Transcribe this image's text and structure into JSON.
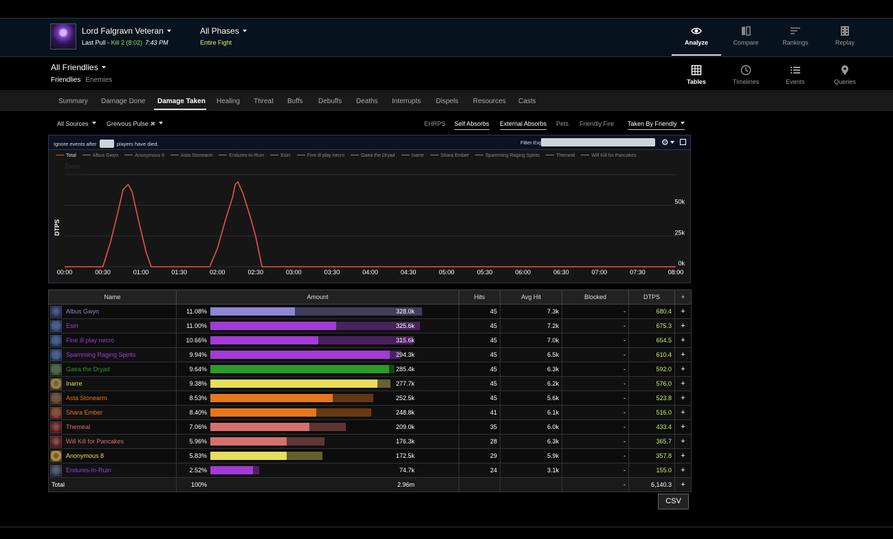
{
  "header": {
    "boss_name": "Lord Falgravn Veteran",
    "pull_prefix": "Last Pull - ",
    "pull_kill": "Kill 2 (8:02)",
    "pull_time": "7:43 PM",
    "phase_name": "All Phases",
    "phase_sub": "Entire Fight",
    "nav": [
      {
        "label": "Analyze",
        "icon": "eye-icon"
      },
      {
        "label": "Compare",
        "icon": "compare-icon"
      },
      {
        "label": "Rankings",
        "icon": "rankings-icon"
      },
      {
        "label": "Replay",
        "icon": "film-icon"
      }
    ]
  },
  "subheader": {
    "title": "All Friendlies",
    "tab_friendlies": "Friendlies",
    "tab_enemies": "Enemies",
    "nav": [
      {
        "label": "Tables",
        "icon": "grid-icon"
      },
      {
        "label": "Timelines",
        "icon": "clock-icon"
      },
      {
        "label": "Events",
        "icon": "list-icon"
      },
      {
        "label": "Queries",
        "icon": "map-pin-icon"
      }
    ]
  },
  "tabs": [
    "Summary",
    "Damage Done",
    "Damage Taken",
    "Healing",
    "Threat",
    "Buffs",
    "Debuffs",
    "Deaths",
    "Interrupts",
    "Dispels",
    "Resources",
    "Casts"
  ],
  "active_tab": "Damage Taken",
  "filters": {
    "sources": "All Sources",
    "ability": "Greivous Pulse",
    "ehrps": "EHRPS",
    "self_absorbs": "Self Absorbs",
    "external_absorbs": "External Absorbs",
    "pets": "Pets",
    "friendly_fire": "Friendly Fire",
    "taken_by": "Taken By Friendly"
  },
  "ignore": {
    "before": "Ignore events after",
    "after": "players have died.",
    "filter_label": "Filter Expression:",
    "filter_value": ""
  },
  "legend": [
    "Total",
    "Albus Gwyn",
    "Anonymous 8",
    "Asta Stonearm",
    "Endures-In-Ruin",
    "Esirr",
    "Fine ill play necro",
    "Gaea the Dryad",
    "Inarre",
    "Shara Ember",
    "Spamming Raging Spirits",
    "Themeal",
    "Will Kill for Pancakes"
  ],
  "chart_data": {
    "type": "line",
    "ylabel": "DTPS",
    "zoom_label": "Zoom",
    "x_ticks": [
      "00:00",
      "00:30",
      "01:00",
      "01:30",
      "02:00",
      "02:30",
      "03:00",
      "03:30",
      "04:00",
      "04:30",
      "05:00",
      "05:30",
      "06:00",
      "06:30",
      "07:00",
      "07:30",
      "08:00"
    ],
    "y_ticks": [
      "0k",
      "25k",
      "50k"
    ],
    "ylim": [
      0,
      75000
    ],
    "xlim_seconds": [
      0,
      480
    ],
    "series": [
      {
        "name": "Total",
        "color": "#e8524a",
        "points": [
          [
            0,
            0
          ],
          [
            30,
            0
          ],
          [
            36,
            20000
          ],
          [
            42,
            45000
          ],
          [
            46,
            63000
          ],
          [
            50,
            67000
          ],
          [
            53,
            61000
          ],
          [
            58,
            38000
          ],
          [
            64,
            12000
          ],
          [
            68,
            0
          ],
          [
            114,
            0
          ],
          [
            120,
            15000
          ],
          [
            126,
            37000
          ],
          [
            132,
            57000
          ],
          [
            134,
            67000
          ],
          [
            136,
            69000
          ],
          [
            140,
            60000
          ],
          [
            146,
            40000
          ],
          [
            150,
            25000
          ],
          [
            153,
            10000
          ],
          [
            155,
            0
          ],
          [
            480,
            0
          ]
        ]
      }
    ]
  },
  "table": {
    "headers": [
      "Name",
      "Amount",
      "Hits",
      "Avg Hit",
      "Blocked",
      "DTPS",
      "+"
    ],
    "rows": [
      {
        "name": "Albus Gwyn",
        "color": "#8f86d8",
        "pct": "11.08%",
        "frac": 0.4,
        "amount": "328.0k",
        "hits": "45",
        "avg": "7.3k",
        "blocked": "-",
        "dtps": "680.4",
        "bar_full": 1.0,
        "icon_bg": "#2d3f8a"
      },
      {
        "name": "Esirr",
        "color": "#a23bd6",
        "pct": "11.00%",
        "frac": 0.6,
        "amount": "325.6k",
        "hits": "45",
        "avg": "7.2k",
        "blocked": "-",
        "dtps": "675.3",
        "bar_full": 0.99,
        "icon_bg": "#2d57a8"
      },
      {
        "name": "Fine ill play necro",
        "color": "#a23bd6",
        "pct": "10.66%",
        "frac": 0.53,
        "amount": "315.6k",
        "hits": "45",
        "avg": "7.0k",
        "blocked": "-",
        "dtps": "654.5",
        "bar_full": 0.96,
        "icon_bg": "#2d57a8"
      },
      {
        "name": "Spamming Raging Spirits",
        "color": "#a23bd6",
        "pct": "9.94%",
        "frac": 0.94,
        "amount": "294.3k",
        "hits": "45",
        "avg": "6.5k",
        "blocked": "-",
        "dtps": "610.4",
        "bar_full": 0.9,
        "icon_bg": "#2d57a8"
      },
      {
        "name": "Gaea the Dryad",
        "color": "#2a9a2a",
        "pct": "9.64%",
        "frac": 0.97,
        "amount": "285.4k",
        "hits": "45",
        "avg": "6.3k",
        "blocked": "-",
        "dtps": "592.0",
        "bar_full": 0.87,
        "icon_bg": "#3f6e3a"
      },
      {
        "name": "Inarre",
        "color": "#e8de58",
        "pct": "9.38%",
        "frac": 0.93,
        "amount": "277.7k",
        "hits": "45",
        "avg": "6.2k",
        "blocked": "-",
        "dtps": "576.0",
        "bar_full": 0.85,
        "icon_bg": "#b08a30"
      },
      {
        "name": "Asta Stonearm",
        "color": "#e8771c",
        "pct": "8.53%",
        "frac": 0.75,
        "amount": "252.5k",
        "hits": "45",
        "avg": "5.6k",
        "blocked": "-",
        "dtps": "523.8",
        "bar_full": 0.77,
        "icon_bg": "#7a4a2a"
      },
      {
        "name": "Shara Ember",
        "color": "#e8771c",
        "pct": "8.40%",
        "frac": 0.66,
        "amount": "248.8k",
        "hits": "41",
        "avg": "6.1k",
        "blocked": "-",
        "dtps": "516.0",
        "bar_full": 0.76,
        "icon_bg": "#a83a1a"
      },
      {
        "name": "Themeal",
        "color": "#d6706e",
        "pct": "7.06%",
        "frac": 0.73,
        "amount": "209.0k",
        "hits": "35",
        "avg": "6.0k",
        "blocked": "-",
        "dtps": "433.4",
        "bar_full": 0.64,
        "icon_bg": "#8a1a1a"
      },
      {
        "name": "Will Kill for Pancakes",
        "color": "#d6706e",
        "pct": "5.96%",
        "frac": 0.67,
        "amount": "176.3k",
        "hits": "28",
        "avg": "6.3k",
        "blocked": "-",
        "dtps": "365.7",
        "bar_full": 0.54,
        "icon_bg": "#8a1a1a"
      },
      {
        "name": "Anonymous 8",
        "color": "#e8de58",
        "pct": "5.83%",
        "frac": 0.68,
        "amount": "172.5k",
        "hits": "29",
        "avg": "5.9k",
        "blocked": "-",
        "dtps": "357.8",
        "bar_full": 0.53,
        "icon_bg": "#c89a20"
      },
      {
        "name": "Endures-In-Ruin",
        "color": "#a23bd6",
        "pct": "2.52%",
        "frac": 0.87,
        "amount": "74.7k",
        "hits": "24",
        "avg": "3.1k",
        "blocked": "-",
        "dtps": "155.0",
        "bar_full": 0.23,
        "icon_bg": "#3a4a6a"
      }
    ],
    "total": {
      "name": "Total",
      "pct": "100%",
      "amount": "2.96m",
      "hits": "",
      "avg": "",
      "blocked": "-",
      "dtps": "6,140.3"
    }
  },
  "csv_label": "CSV"
}
